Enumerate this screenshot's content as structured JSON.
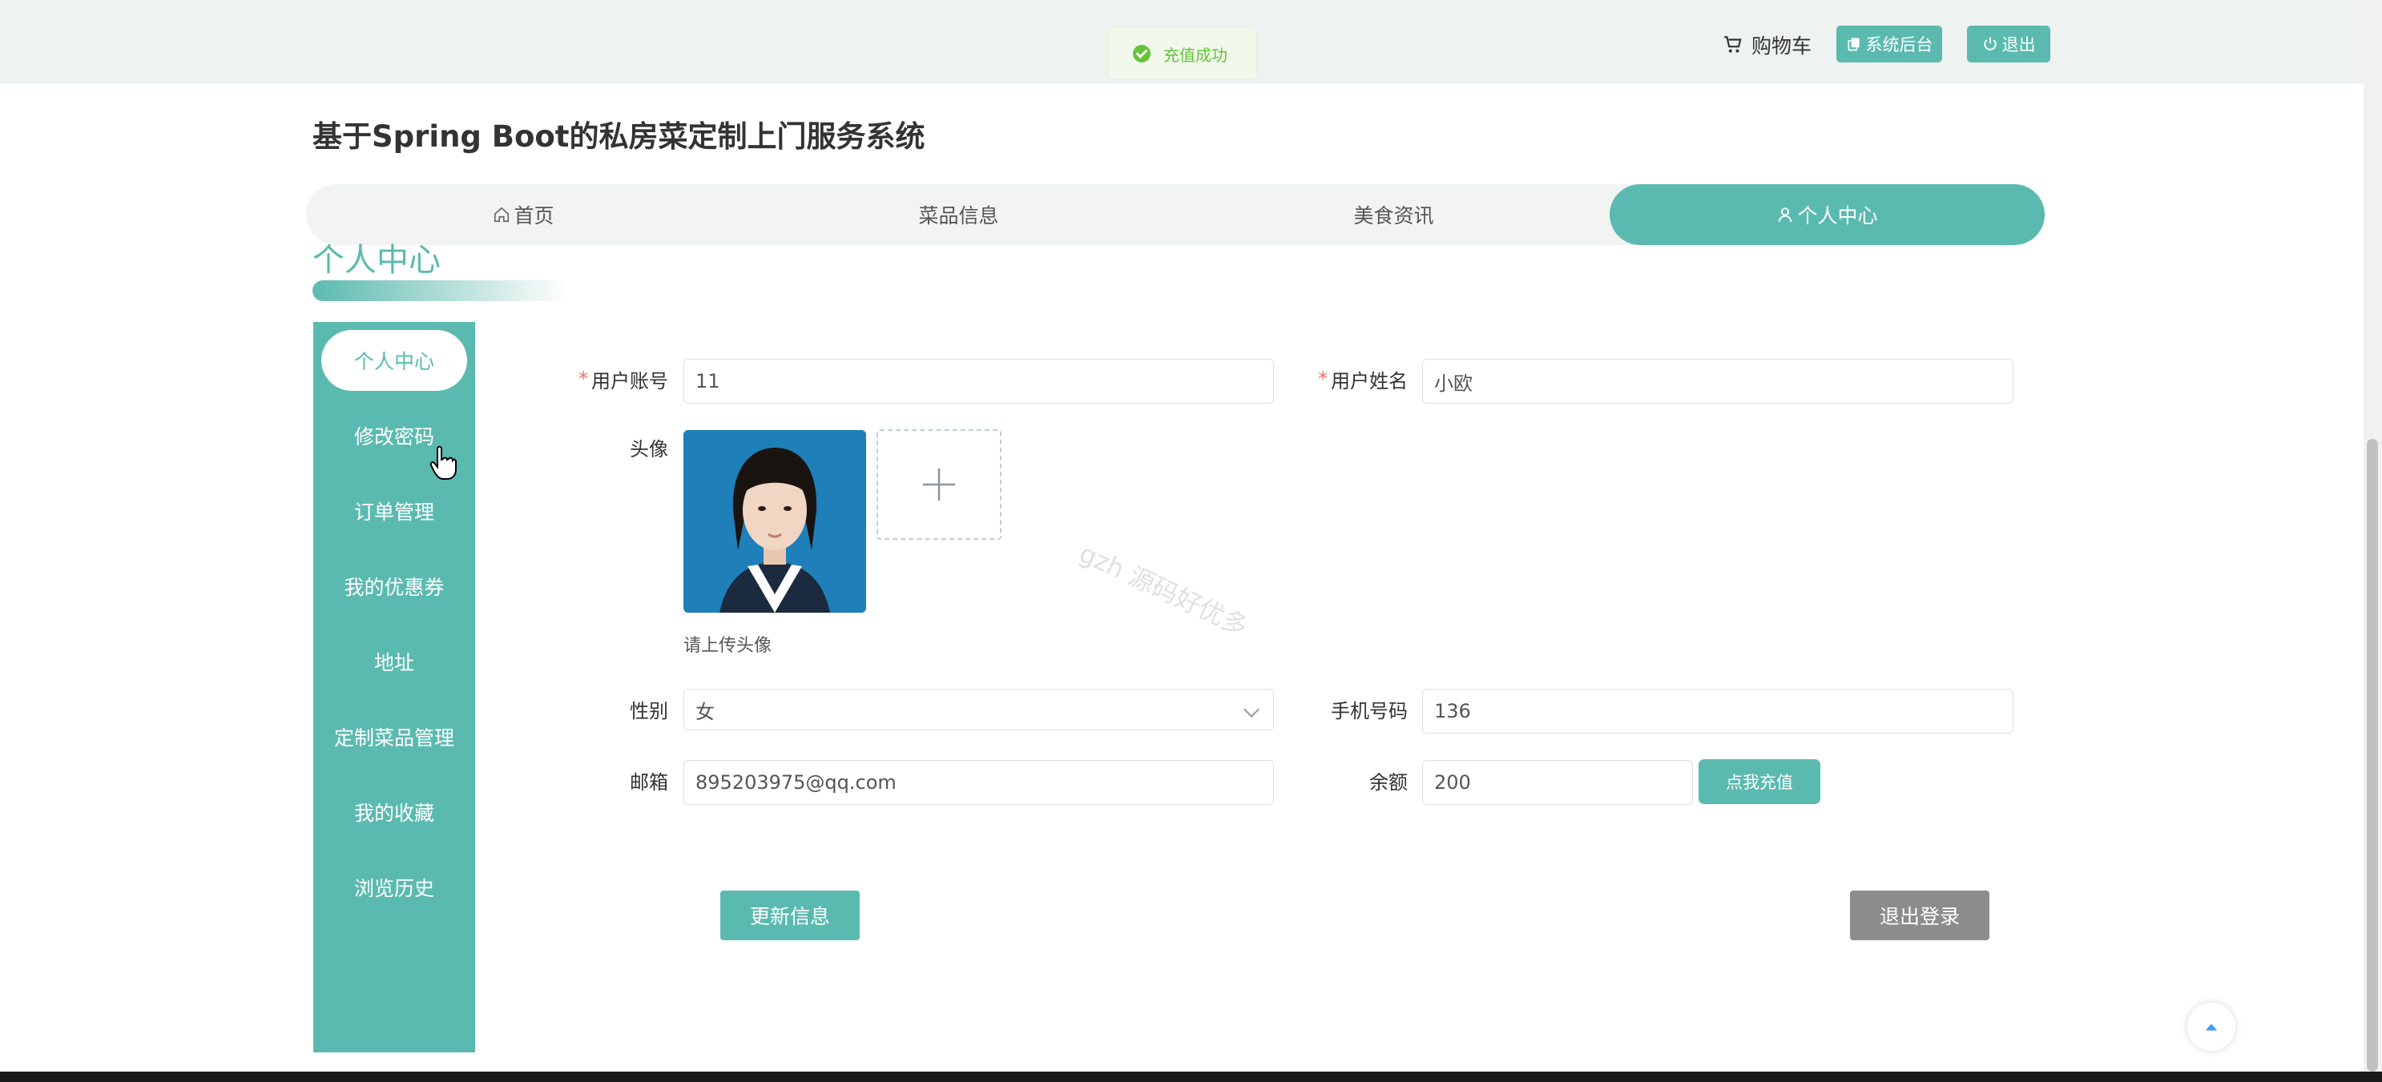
{
  "toast": {
    "text": "充值成功"
  },
  "header": {
    "cart_label": "购物车",
    "admin_label": "系统后台",
    "exit_label": "退出"
  },
  "site": {
    "title": "基于Spring Boot的私房菜定制上门服务系统"
  },
  "nav": {
    "items": [
      {
        "label": "首页",
        "icon": "home-icon"
      },
      {
        "label": "菜品信息"
      },
      {
        "label": "美食资讯"
      },
      {
        "label": "个人中心",
        "icon": "user-icon",
        "active": true
      }
    ]
  },
  "section": {
    "title": "个人中心"
  },
  "sidebar": {
    "items": [
      {
        "label": "个人中心",
        "active": true
      },
      {
        "label": "修改密码"
      },
      {
        "label": "订单管理"
      },
      {
        "label": "我的优惠券"
      },
      {
        "label": "地址"
      },
      {
        "label": "定制菜品管理"
      },
      {
        "label": "我的收藏"
      },
      {
        "label": "浏览历史"
      }
    ]
  },
  "form": {
    "account_label": "用户账号",
    "account_value": "11",
    "name_label": "用户姓名",
    "name_value": "小欧",
    "avatar_label": "头像",
    "avatar_hint": "请上传头像",
    "gender_label": "性别",
    "gender_value": "女",
    "phone_label": "手机号码",
    "phone_value": "136",
    "email_label": "邮箱",
    "email_value": "895203975@qq.com",
    "balance_label": "余额",
    "balance_value": "200",
    "recharge_label": "点我充值",
    "update_label": "更新信息",
    "logout_label": "退出登录"
  },
  "watermark": {
    "text": "gzh 源码好优多"
  },
  "colors": {
    "accent": "#5bbab0",
    "logout": "#8c8c8c",
    "success": "#67c23a",
    "required": "#f56c6c"
  }
}
